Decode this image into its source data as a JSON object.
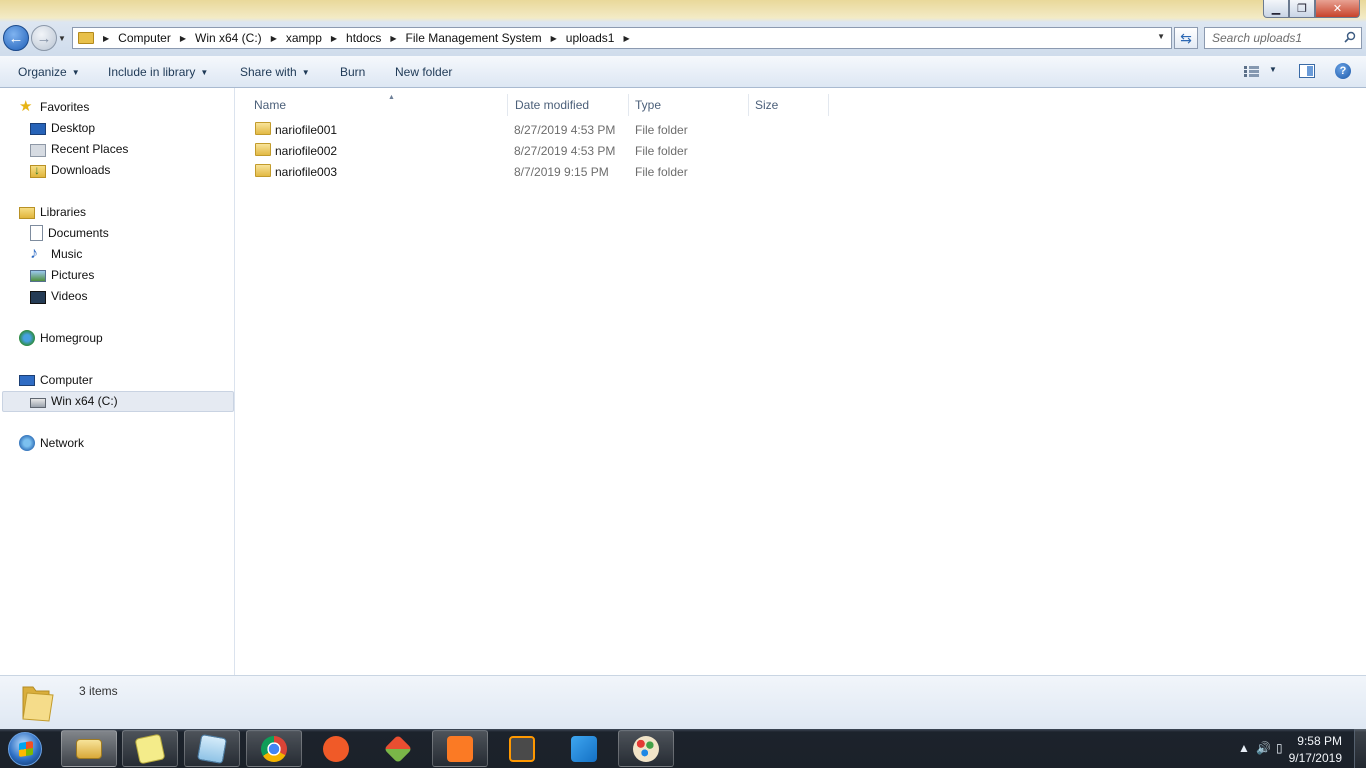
{
  "window": {
    "controls": {
      "minimize": "▁",
      "maximize": "❐",
      "close": "✕"
    }
  },
  "address": {
    "breadcrumbs": [
      "Computer",
      "Win x64 (C:)",
      "xampp",
      "htdocs",
      "File Management System",
      "uploads1"
    ]
  },
  "search": {
    "placeholder": "Search uploads1"
  },
  "toolbar": {
    "organize": "Organize",
    "include_in_library": "Include in library",
    "share_with": "Share with",
    "burn": "Burn",
    "new_folder": "New folder",
    "help": "?"
  },
  "nav": {
    "favorites": "Favorites",
    "desktop": "Desktop",
    "recent_places": "Recent Places",
    "downloads": "Downloads",
    "libraries": "Libraries",
    "documents": "Documents",
    "music": "Music",
    "pictures": "Pictures",
    "videos": "Videos",
    "homegroup": "Homegroup",
    "computer": "Computer",
    "drive": "Win x64 (C:)",
    "network": "Network"
  },
  "columns": {
    "name": "Name",
    "date_modified": "Date modified",
    "type": "Type",
    "size": "Size"
  },
  "files": [
    {
      "name": "nariofile001",
      "date": "8/27/2019 4:53 PM",
      "type": "File folder"
    },
    {
      "name": "nariofile002",
      "date": "8/27/2019 4:53 PM",
      "type": "File folder"
    },
    {
      "name": "nariofile003",
      "date": "8/7/2019 9:15 PM",
      "type": "File folder"
    }
  ],
  "status": {
    "item_count": "3 items"
  },
  "taskbar": {
    "pinned": [
      "explorer-icon",
      "sticky-notes-icon",
      "notepad-icon",
      "chrome-icon",
      "pen-tool-icon",
      "git-icon",
      "xampp-icon",
      "sublime-text-icon",
      "vscode-icon",
      "paint-icon"
    ],
    "clock_time": "9:58 PM",
    "clock_date": "9/17/2019"
  },
  "colors": {
    "accent": "#2c68b4",
    "folder": "#e2b944",
    "taskbar": "#1b2129"
  }
}
